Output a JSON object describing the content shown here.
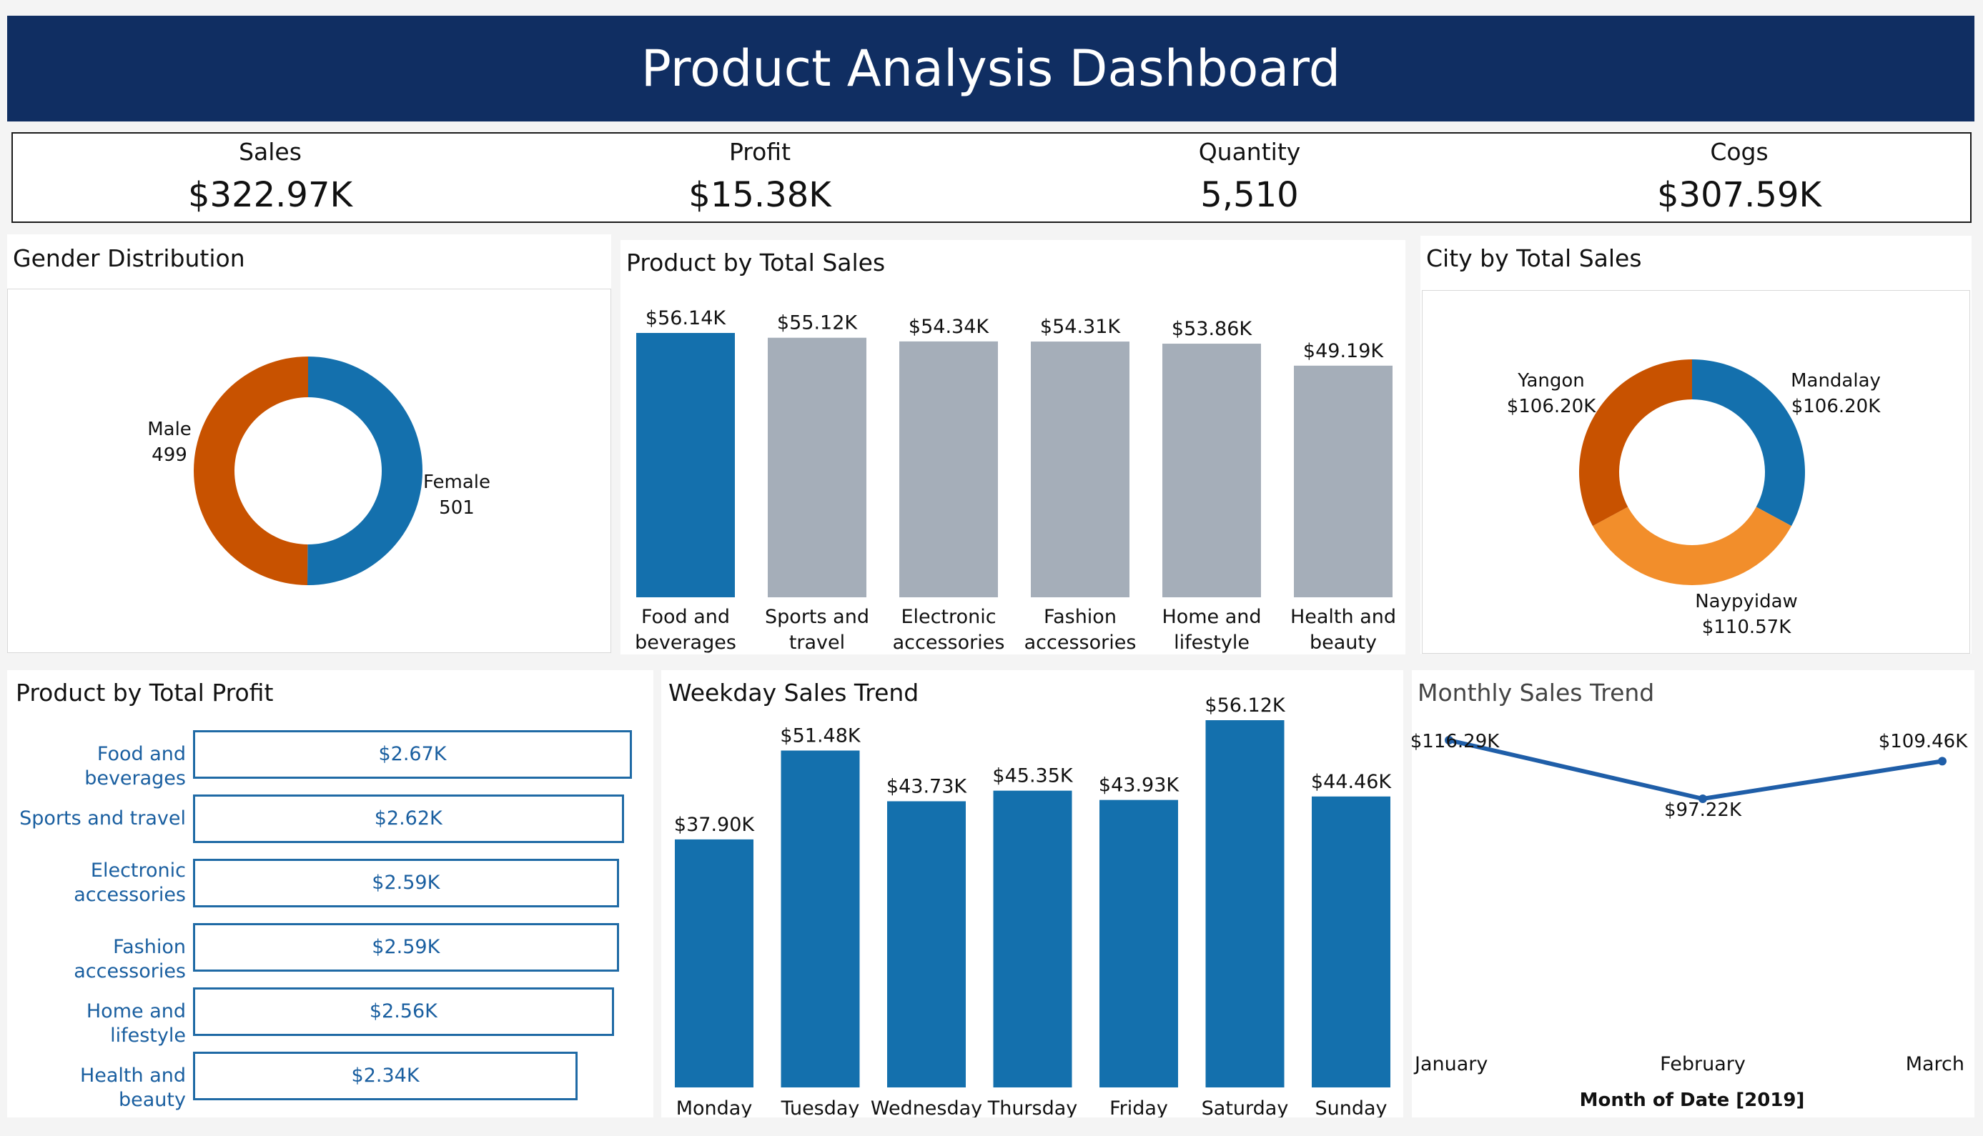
{
  "dashboard": {
    "title": "Product Analysis Dashboard",
    "colors": {
      "header": "#102e62",
      "primary": "#1470ad",
      "orange": "#c85200",
      "light_orange": "#f28e2b",
      "gray": "#a5aeb9"
    }
  },
  "kpis": [
    {
      "label": "Sales",
      "value": "$322.97K"
    },
    {
      "label": "Profit",
      "value": "$15.38K"
    },
    {
      "label": "Quantity",
      "value": "5,510"
    },
    {
      "label": "Cogs",
      "value": "$307.59K"
    }
  ],
  "chart_data": [
    {
      "id": "gender",
      "type": "pie",
      "title": "Gender Distribution",
      "categories": [
        "Female",
        "Male"
      ],
      "values": [
        501,
        499
      ],
      "labels": [
        [
          "Female",
          "501"
        ],
        [
          "Male",
          "499"
        ]
      ],
      "colors": [
        "#1470ad",
        "#c85200"
      ],
      "donut": true
    },
    {
      "id": "product_sales",
      "type": "bar",
      "title": "Product by Total Sales",
      "categories": [
        [
          "Food and",
          "beverages"
        ],
        [
          "Sports and",
          "travel"
        ],
        [
          "Electronic",
          "accessories"
        ],
        [
          "Fashion",
          "accessories"
        ],
        [
          "Home and",
          "lifestyle"
        ],
        [
          "Health and",
          "beauty"
        ]
      ],
      "values": [
        56.14,
        55.12,
        54.34,
        54.31,
        53.86,
        49.19
      ],
      "data_labels": [
        "$56.14K",
        "$55.12K",
        "$54.34K",
        "$54.31K",
        "$53.86K",
        "$49.19K"
      ],
      "colors": [
        "#1470ad",
        "#a5aeb9",
        "#a5aeb9",
        "#a5aeb9",
        "#a5aeb9",
        "#a5aeb9"
      ],
      "ylim": [
        0,
        56.14
      ]
    },
    {
      "id": "city_sales",
      "type": "pie",
      "title": "City by Total Sales",
      "categories": [
        "Mandalay",
        "Naypyidaw",
        "Yangon"
      ],
      "values": [
        106.2,
        110.57,
        106.2
      ],
      "labels": [
        [
          "Mandalay",
          "$106.20K"
        ],
        [
          "Naypyidaw",
          "$110.57K"
        ],
        [
          "Yangon",
          "$106.20K"
        ]
      ],
      "colors": [
        "#1470ad",
        "#f28e2b",
        "#c85200"
      ],
      "donut": true
    },
    {
      "id": "product_profit",
      "type": "bar",
      "orientation": "horizontal",
      "title": "Product by Total Profit",
      "categories": [
        [
          "Food and beverages"
        ],
        [
          "Sports and travel"
        ],
        [
          "Electronic",
          "accessories"
        ],
        [
          "Fashion accessories"
        ],
        [
          "Home and lifestyle"
        ],
        [
          "Health and beauty"
        ]
      ],
      "values": [
        2.67,
        2.62,
        2.59,
        2.59,
        2.56,
        2.34
      ],
      "data_labels": [
        "$2.67K",
        "$2.62K",
        "$2.59K",
        "$2.59K",
        "$2.56K",
        "$2.34K"
      ],
      "xlim": [
        0,
        2.67
      ]
    },
    {
      "id": "weekday_sales",
      "type": "bar",
      "title": "Weekday Sales Trend",
      "categories": [
        "Monday",
        "Tuesday",
        "Wednesday",
        "Thursday",
        "Friday",
        "Saturday",
        "Sunday"
      ],
      "values": [
        37.9,
        51.48,
        43.73,
        45.35,
        43.93,
        56.12,
        44.46
      ],
      "data_labels": [
        "$37.90K",
        "$51.48K",
        "$43.73K",
        "$45.35K",
        "$43.93K",
        "$56.12K",
        "$44.46K"
      ],
      "color": "#1470ad",
      "ylim": [
        0,
        56.12
      ]
    },
    {
      "id": "monthly_sales",
      "type": "line",
      "title": "Monthly Sales Trend",
      "categories": [
        "January",
        "February",
        "March"
      ],
      "values": [
        116.29,
        97.22,
        109.46
      ],
      "data_labels": [
        "$116.29K",
        "$97.22K",
        "$109.46K"
      ],
      "xlabel": "Month of Date [2019]",
      "color": "#1f5ea8",
      "ylim": [
        0,
        116.29
      ]
    }
  ]
}
